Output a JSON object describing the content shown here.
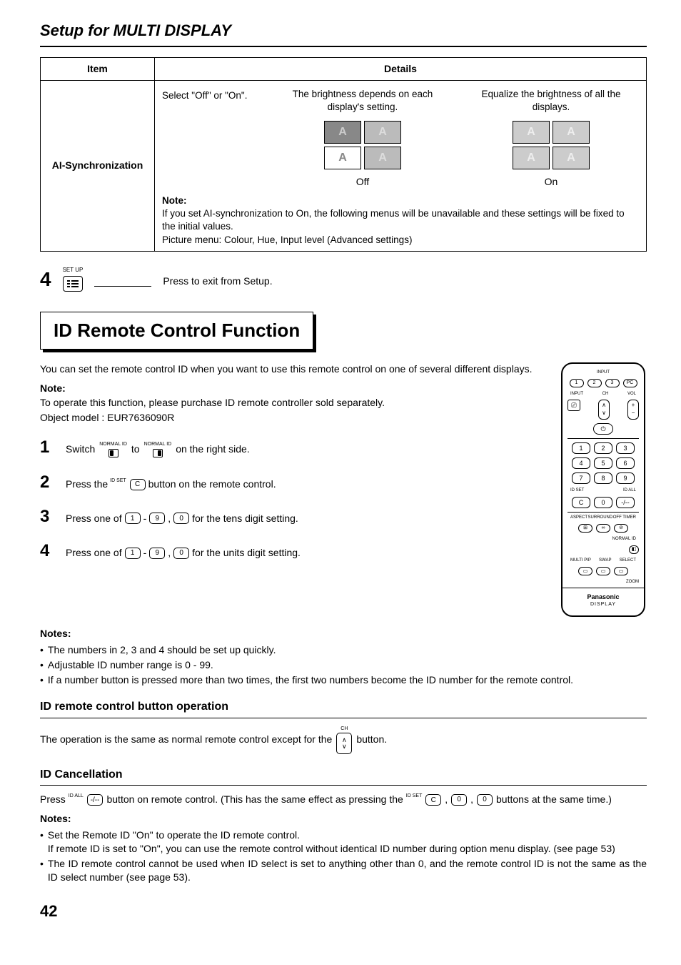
{
  "page": {
    "number": "42",
    "section_title": "Setup for MULTI DISPLAY"
  },
  "details_table": {
    "header_item": "Item",
    "header_details": "Details",
    "row_item": "AI-Synchronization",
    "select_text": "Select \"Off\" or \"On\".",
    "col_off_caption": "The brightness depends on each display's setting.",
    "col_on_caption": "Equalize the brightness of all the displays.",
    "glyph": "A",
    "off_label": "Off",
    "on_label": "On",
    "note_title": "Note:",
    "note_line1": "If you set AI-synchronization to On, the following menus will be unavailable and these settings will be fixed to the initial values.",
    "note_line2": "Picture menu: Colour, Hue, Input level (Advanced settings)"
  },
  "step4": {
    "num": "4",
    "setup_label": "SET UP",
    "text": "Press to exit from Setup."
  },
  "id_section": {
    "title": "ID Remote Control Function",
    "intro": "You can set the remote control ID when you want to use this remote control on one of several different displays.",
    "note_head": "Note:",
    "note_line1": "To operate this function, please purchase ID remote controller sold separately.",
    "note_line2": "Object model : EUR7636090R"
  },
  "steps": {
    "s1": {
      "n": "1",
      "pre": "Switch",
      "sw_label": "NORMAL   ID",
      "mid": "to",
      "post": "on the right side."
    },
    "s2": {
      "n": "2",
      "pre": "Press the",
      "btn_super": "ID SET",
      "btn": "C",
      "post": "button on the remote control."
    },
    "s3": {
      "n": "3",
      "pre": "Press one of",
      "b1": "1",
      "dash": "-",
      "b9": "9",
      "comma": ",",
      "b0": "0",
      "post": "for the tens digit setting."
    },
    "s4": {
      "n": "4",
      "pre": "Press one of",
      "b1": "1",
      "dash": "-",
      "b9": "9",
      "comma": ",",
      "b0": "0",
      "post": "for the units digit setting."
    }
  },
  "notes2": {
    "head": "Notes:",
    "b1": "The numbers in 2, 3 and 4 should be set up quickly.",
    "b2": "Adjustable ID number range is 0 - 99.",
    "b3": "If a number button is pressed more than two times, the first two numbers become the ID number for the remote control."
  },
  "operation": {
    "head": "ID remote control button operation",
    "pre": "The operation is the same as normal remote control except for the",
    "btn_top": "CH",
    "post": "button."
  },
  "cancel": {
    "head": "ID Cancellation",
    "pre": "Press",
    "btn1_super": "ID ALL",
    "btn1": "-/--",
    "mid": "button on remote control. (This has the same effect as pressing the",
    "btnC_super": "ID SET",
    "btnC": "C",
    "c1": ",",
    "btn0a": "0",
    "c2": ",",
    "btn0b": "0",
    "post": "buttons at the same time.)"
  },
  "notes3": {
    "head": "Notes:",
    "b1a": "Set the Remote ID \"On\" to operate the ID remote control.",
    "b1b": "If remote ID is set to \"On\", you can use the remote control without identical ID number during option menu display. (see page 53)",
    "b2": "The ID remote control cannot be used when ID select is set to anything other than 0, and the remote control ID is not the same as the ID select number (see page 53)."
  },
  "remote": {
    "input": "INPUT",
    "ch": "CH",
    "vol": "VOL",
    "btns_top": [
      "1",
      "2",
      "3",
      "PC"
    ],
    "pow": "⏻",
    "nums": [
      "1",
      "2",
      "3",
      "4",
      "5",
      "6",
      "7",
      "8",
      "9",
      "C",
      "0",
      "-/--"
    ],
    "idset": "ID SET",
    "idall": "ID ALL",
    "aspect": "ASPECT",
    "surround": "SURROUND",
    "off": "OFF TIMER",
    "normal": "NORMAL",
    "id": "ID",
    "multi": "MULTI PIP",
    "swap": "SWAP",
    "select": "SELECT",
    "zoom": "ZOOM",
    "brand": "Panasonic",
    "display": "DISPLAY"
  }
}
